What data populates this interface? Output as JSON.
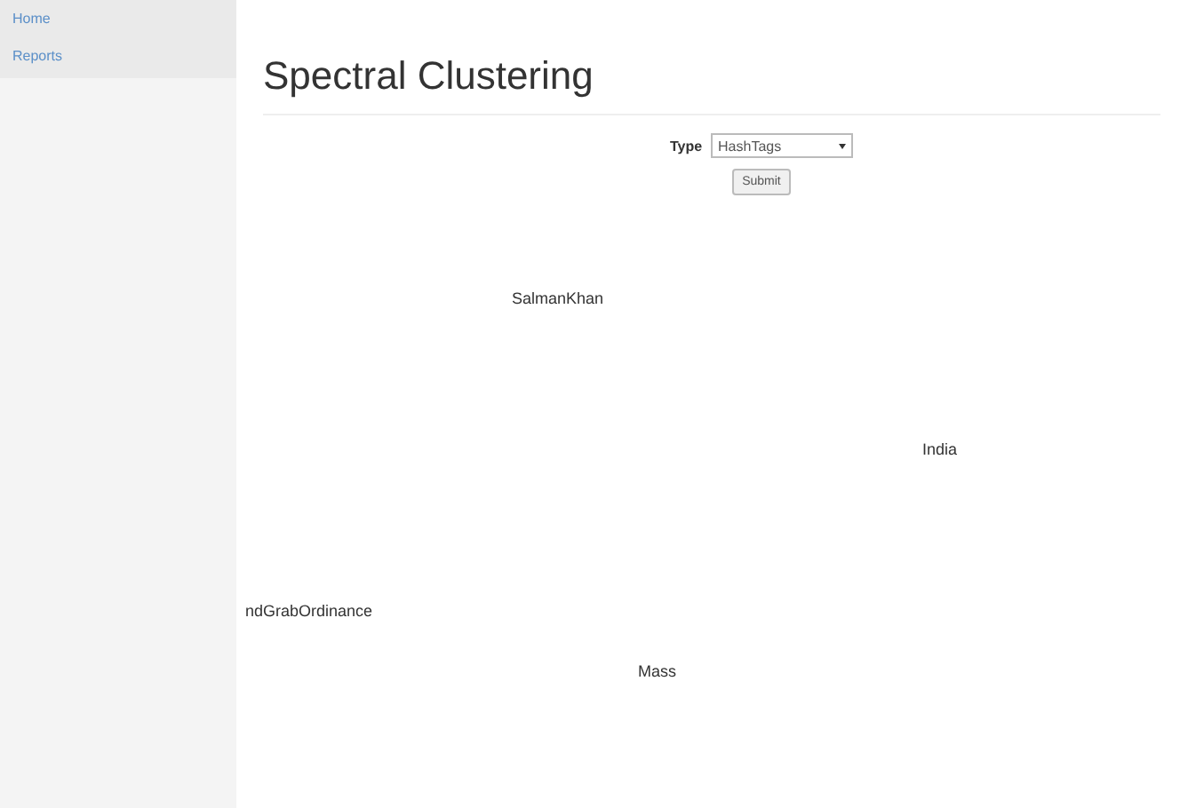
{
  "sidebar": {
    "items": [
      {
        "label": "Home"
      },
      {
        "label": "Reports"
      }
    ]
  },
  "title": "Spectral Clustering",
  "form": {
    "label": "Type",
    "select_value": "HashTags",
    "submit": "Submit"
  },
  "cloud": {
    "words": [
      "SalmanKhan",
      "India",
      "ndGrabOrdinance",
      "Mass"
    ]
  }
}
